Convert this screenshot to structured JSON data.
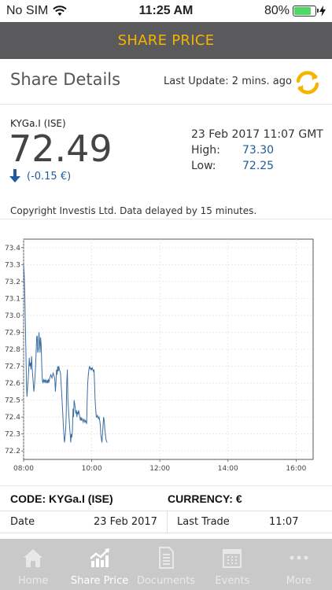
{
  "status_bar": {
    "carrier": "No SIM",
    "time": "11:25 AM",
    "battery": "80%",
    "battery_level": 0.8
  },
  "nav": {
    "title": "SHARE PRICE"
  },
  "details": {
    "title": "Share Details",
    "last_update": "Last Update: 2 mins. ago",
    "ticker": "KYGa.I (ISE)",
    "price": "72.49",
    "change": "(-0.15 €)",
    "timestamp": "23 Feb 2017 11:07 GMT",
    "high_label": "High:",
    "high_value": "73.30",
    "low_label": "Low:",
    "low_value": "72.25"
  },
  "copyright": "Copyright Investis Ltd. Data delayed by 15 minutes.",
  "chart_data": {
    "type": "line",
    "title": "",
    "xlabel": "",
    "ylabel": "",
    "x_ticks": [
      "08:00",
      "10:00",
      "12:00",
      "14:00",
      "16:00"
    ],
    "y_ticks": [
      "72.2",
      "72.3",
      "72.4",
      "72.5",
      "72.6",
      "72.7",
      "72.8",
      "72.9",
      "73.0",
      "73.1",
      "73.2",
      "73.3",
      "73.4"
    ],
    "xlim": [
      480,
      990
    ],
    "ylim": [
      72.15,
      73.45
    ],
    "grid": true,
    "line_color": "#3a6ea5",
    "series": [
      {
        "x": [
          480,
          481,
          482,
          483,
          484,
          485,
          486,
          487,
          488,
          489,
          490,
          491,
          492,
          493,
          494,
          495,
          496,
          497,
          498,
          499,
          500,
          501,
          502,
          503,
          504,
          505,
          506,
          507,
          508,
          509,
          510,
          511,
          512,
          513,
          514,
          515,
          516,
          517,
          518,
          519,
          520,
          521,
          522,
          523,
          524,
          525,
          526,
          528,
          530,
          532,
          534,
          535,
          536,
          537,
          538,
          539,
          540,
          541,
          542,
          543,
          544,
          545,
          546,
          547,
          548,
          549,
          550,
          551,
          552,
          553,
          554,
          555,
          556,
          557,
          558,
          559,
          560,
          561,
          562,
          563,
          564,
          565,
          566,
          567,
          568,
          569,
          570,
          571,
          572,
          573,
          574,
          575,
          576,
          577,
          578,
          579,
          580,
          581,
          582,
          583,
          584,
          585,
          586,
          587,
          588,
          589,
          590,
          591,
          592,
          593,
          594,
          595,
          596,
          597,
          598,
          599,
          600,
          601,
          602,
          603,
          604,
          605,
          606,
          607,
          608,
          609,
          610,
          611,
          612,
          613,
          614,
          615,
          616,
          617,
          618,
          619,
          620,
          621,
          622,
          623,
          624,
          625,
          626,
          627
        ],
        "y": [
          73.3,
          73.25,
          73.15,
          72.95,
          72.8,
          72.6,
          72.52,
          72.58,
          72.62,
          72.68,
          72.75,
          72.7,
          72.72,
          72.68,
          72.76,
          72.7,
          72.65,
          72.6,
          72.55,
          72.58,
          72.63,
          72.7,
          72.78,
          72.87,
          72.88,
          72.78,
          72.8,
          72.9,
          72.85,
          72.78,
          72.87,
          72.82,
          72.7,
          72.62,
          72.6,
          72.62,
          72.61,
          72.62,
          72.6,
          72.62,
          72.61,
          72.6,
          72.62,
          72.6,
          72.62,
          72.61,
          72.63,
          72.65,
          72.63,
          72.66,
          72.64,
          72.62,
          72.55,
          72.6,
          72.68,
          72.65,
          72.7,
          72.67,
          72.7,
          72.68,
          72.67,
          72.66,
          72.6,
          72.55,
          72.48,
          72.42,
          72.35,
          72.3,
          72.25,
          72.28,
          72.32,
          72.4,
          72.6,
          72.68,
          72.5,
          72.45,
          72.4,
          72.35,
          72.3,
          72.25,
          72.3,
          72.28,
          72.32,
          72.45,
          72.4,
          72.5,
          72.48,
          72.45,
          72.42,
          72.44,
          72.4,
          72.43,
          72.42,
          72.44,
          72.42,
          72.4,
          72.38,
          72.4,
          72.38,
          72.39,
          72.38,
          72.37,
          72.39,
          72.38,
          72.37,
          72.38,
          72.37,
          72.36,
          72.5,
          72.6,
          72.65,
          72.68,
          72.7,
          72.69,
          72.68,
          72.69,
          72.68,
          72.69,
          72.68,
          72.67,
          72.68,
          72.6,
          72.5,
          72.45,
          72.4,
          72.4,
          72.41,
          72.4,
          72.39,
          72.4,
          72.38,
          72.36,
          72.3,
          72.27,
          72.25,
          72.3,
          72.35,
          72.4,
          72.38,
          72.33,
          72.3,
          72.27,
          72.26,
          72.25
        ]
      }
    ]
  },
  "footer": {
    "code": "CODE: KYGa.I (ISE)",
    "currency": "CURRENCY: €",
    "date_label": "Date",
    "date_value": "23 Feb 2017",
    "last_trade_label": "Last Trade",
    "last_trade_value": "11:07"
  },
  "tabs": [
    {
      "label": "Home",
      "icon": "home-icon"
    },
    {
      "label": "Share Price",
      "icon": "chart-icon"
    },
    {
      "label": "Documents",
      "icon": "document-icon"
    },
    {
      "label": "Events",
      "icon": "calendar-icon"
    },
    {
      "label": "More",
      "icon": "more-icon"
    }
  ]
}
